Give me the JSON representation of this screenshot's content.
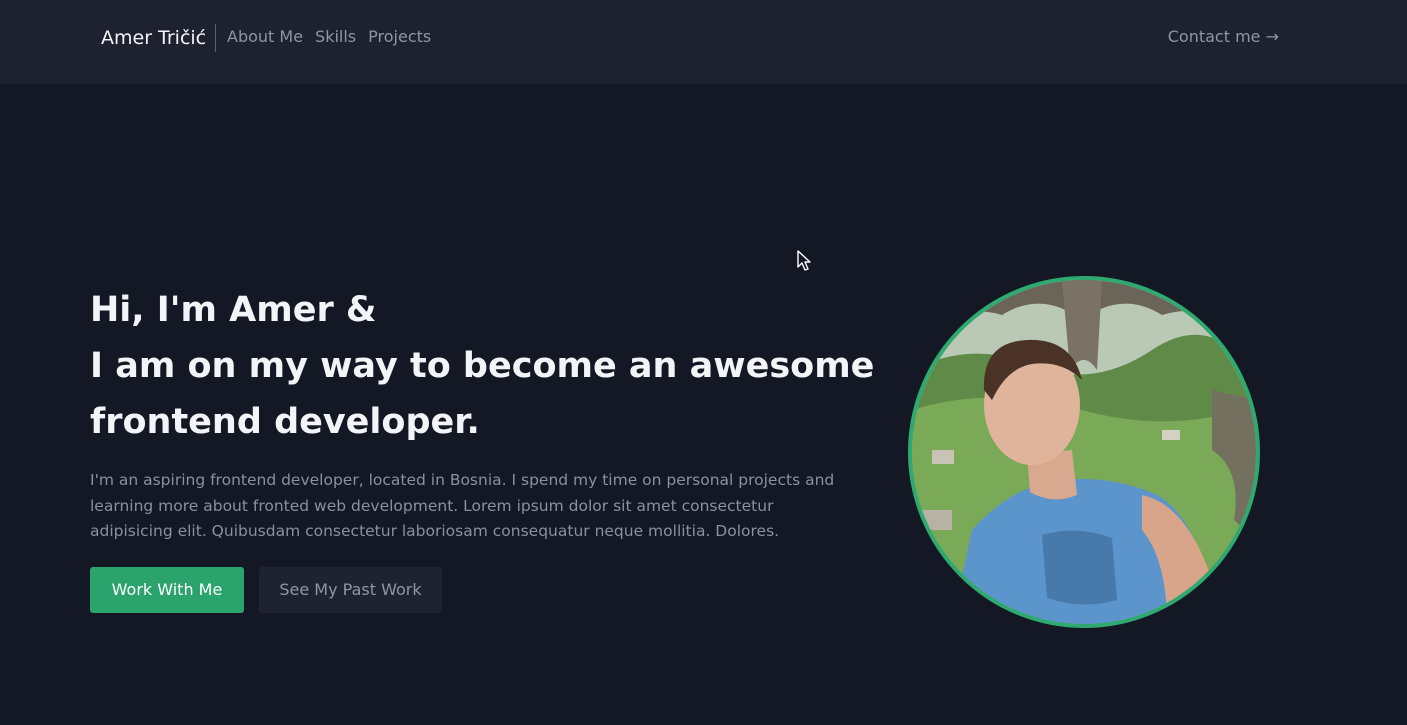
{
  "nav": {
    "brand": "Amer Tričić",
    "links": [
      "About Me",
      "Skills",
      "Projects"
    ],
    "contact": "Contact me →"
  },
  "hero": {
    "title_line1": "Hi, I'm Amer &",
    "title_line2": "I am on my way to become an awesome",
    "title_line3": "frontend developer.",
    "description": "I'm an aspiring frontend developer, located in Bosnia. I spend my time on personal projects and learning more about fronted web development. Lorem ipsum dolor sit amet consectetur adipisicing elit. Quibusdam consectetur laboriosam consequatur neque mollitia. Dolores.",
    "primary_button": "Work With Me",
    "secondary_button": "See My Past Work"
  },
  "colors": {
    "page_background": "#141824",
    "navbar_background": "#1e2230",
    "accent_green": "#2aa46c",
    "text_primary": "#f2f4f7",
    "text_muted": "#8b909e"
  },
  "icons": [
    "mouse-cursor-icon"
  ]
}
